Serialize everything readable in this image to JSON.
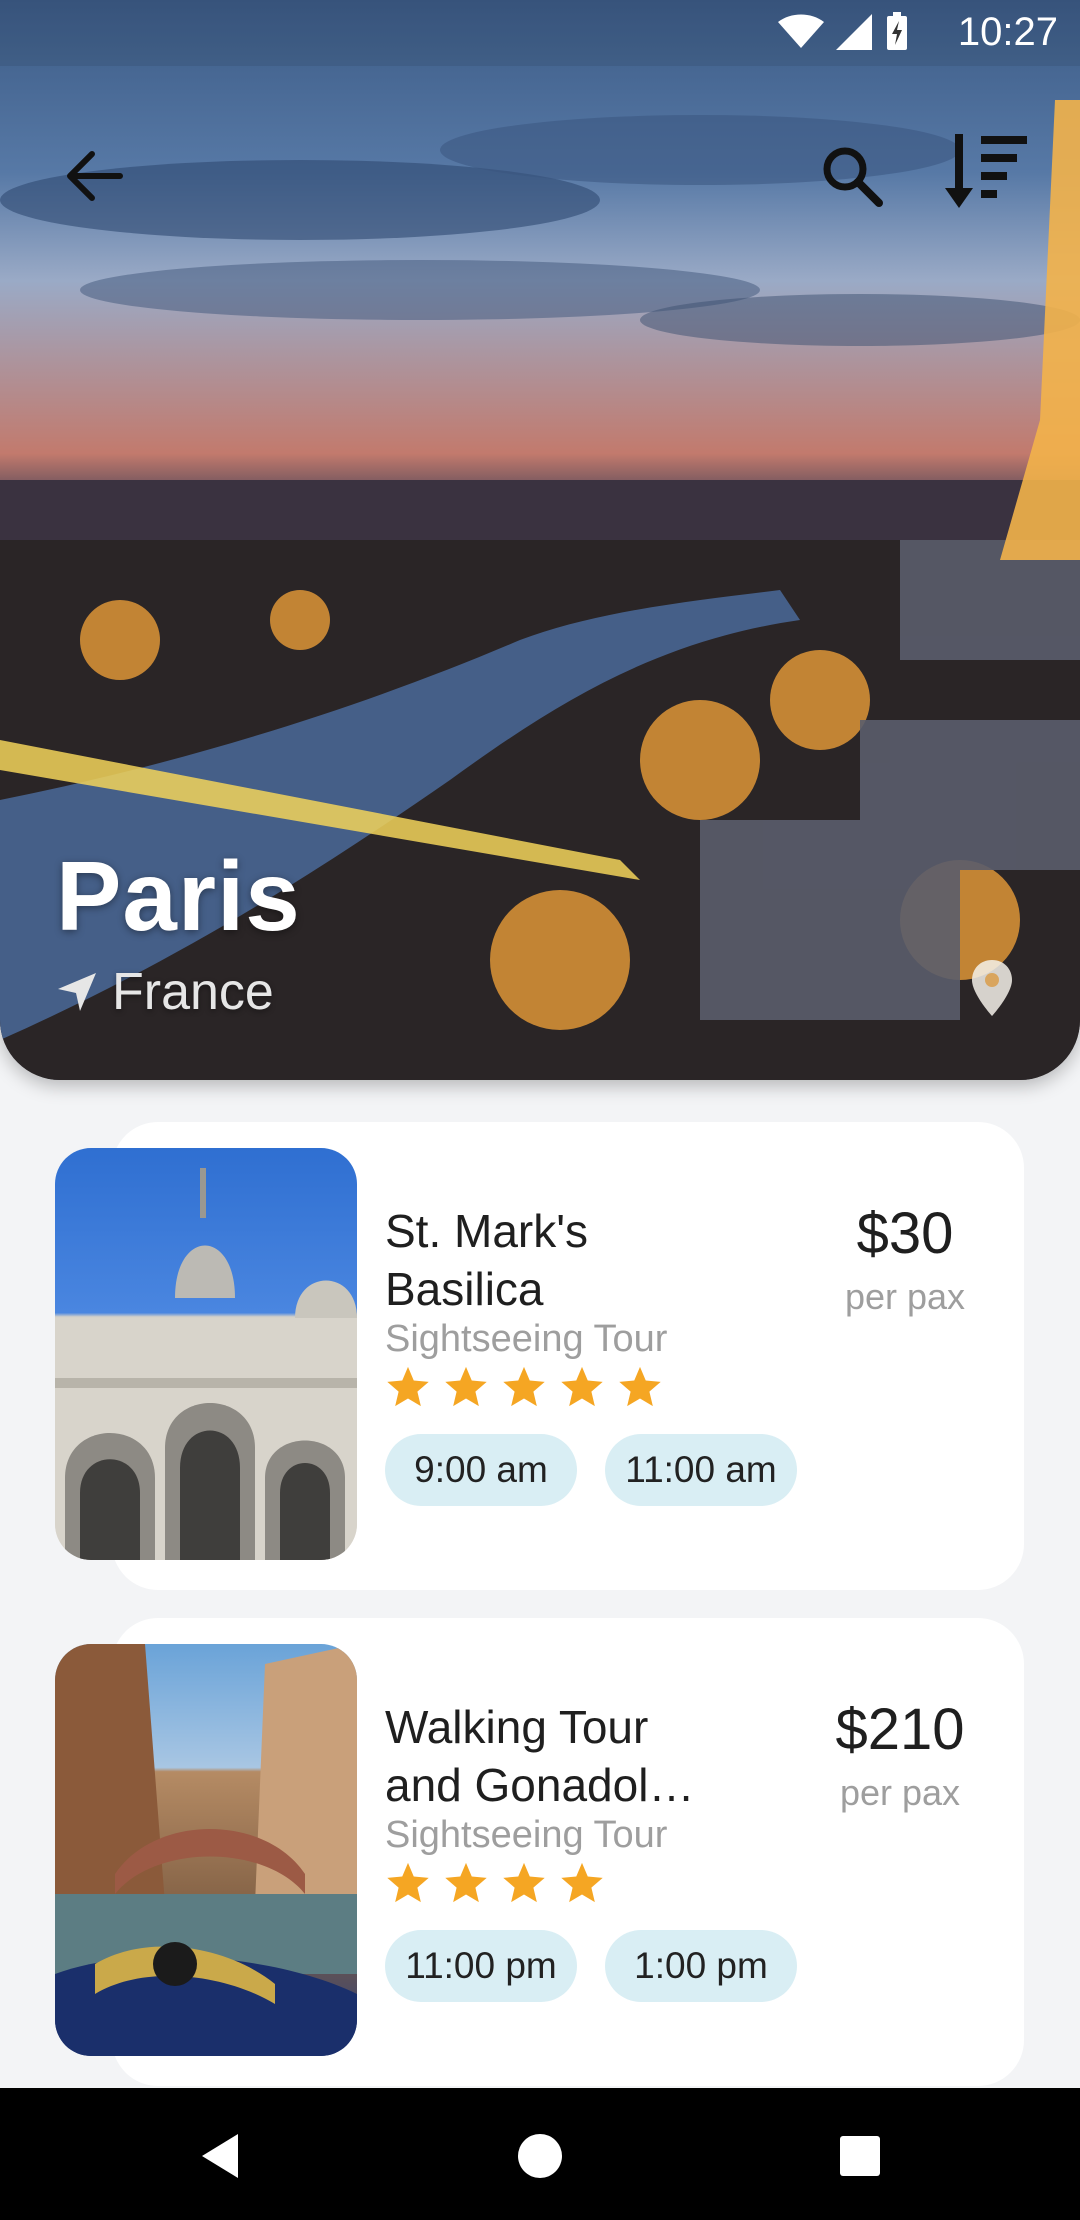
{
  "status": {
    "time": "10:27"
  },
  "hero": {
    "city": "Paris",
    "country": "France"
  },
  "tours": [
    {
      "title": "St. Mark's Basilica",
      "category": "Sightseeing Tour",
      "rating": 5,
      "times": [
        "9:00 am",
        "11:00 am"
      ],
      "price": "$30",
      "price_unit": "per pax"
    },
    {
      "title": "Walking Tour and Gonadol…",
      "category": "Sightseeing Tour",
      "rating": 4,
      "times": [
        "11:00 pm",
        "1:00 pm"
      ],
      "price": "$210",
      "price_unit": "per pax"
    }
  ],
  "icons": {
    "back": "arrow-left-icon",
    "search": "search-icon",
    "sort": "sort-descending-icon",
    "location": "navigation-arrow-icon",
    "map_pin": "map-pin-icon",
    "star": "star-icon"
  },
  "colors": {
    "chip_bg": "#d9eef4",
    "star": "#f5a623",
    "card_bg": "#ffffff",
    "page_bg": "#f3f4f6"
  }
}
